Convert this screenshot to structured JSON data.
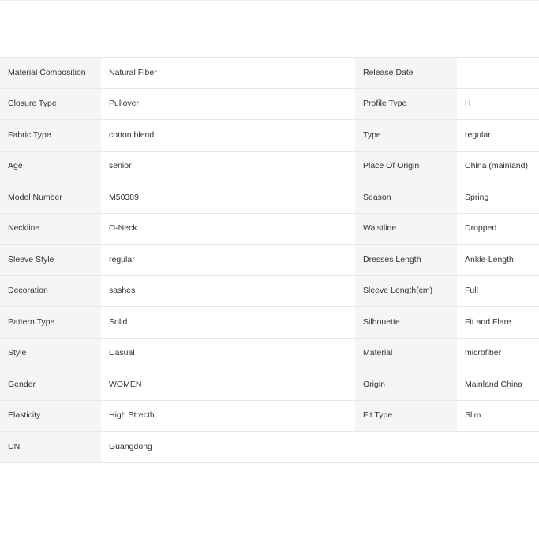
{
  "specs": {
    "rows": [
      {
        "left_label": "Material Composition",
        "left_value": "Natural Fiber",
        "right_label": "Release Date",
        "right_value": ""
      },
      {
        "left_label": "Closure Type",
        "left_value": "Pullover",
        "right_label": "Profile Type",
        "right_value": "H"
      },
      {
        "left_label": "Fabric Type",
        "left_value": "cotton blend",
        "right_label": "Type",
        "right_value": "regular"
      },
      {
        "left_label": "Age",
        "left_value": "senior",
        "right_label": "Place Of Origin",
        "right_value": "China (mainland)"
      },
      {
        "left_label": "Model Number",
        "left_value": "M50389",
        "right_label": "Season",
        "right_value": "Spring"
      },
      {
        "left_label": "Neckline",
        "left_value": "O-Neck",
        "right_label": "Waistline",
        "right_value": "Dropped"
      },
      {
        "left_label": "Sleeve Style",
        "left_value": "regular",
        "right_label": "Dresses Length",
        "right_value": "Ankle-Length"
      },
      {
        "left_label": "Decoration",
        "left_value": "sashes",
        "right_label": "Sleeve Length(cm)",
        "right_value": "Full"
      },
      {
        "left_label": "Pattern Type",
        "left_value": "Solid",
        "right_label": "Silhouette",
        "right_value": "Fit and Flare"
      },
      {
        "left_label": "Style",
        "left_value": "Casual",
        "right_label": "Material",
        "right_value": "microfiber"
      },
      {
        "left_label": "Gender",
        "left_value": "WOMEN",
        "right_label": "Origin",
        "right_value": "Mainland China"
      },
      {
        "left_label": "Elasticity",
        "left_value": "High Strecth",
        "right_label": "Fit Type",
        "right_value": "Slim"
      },
      {
        "left_label": "CN",
        "left_value": "Guangdong",
        "right_label": "",
        "right_value": ""
      }
    ]
  }
}
